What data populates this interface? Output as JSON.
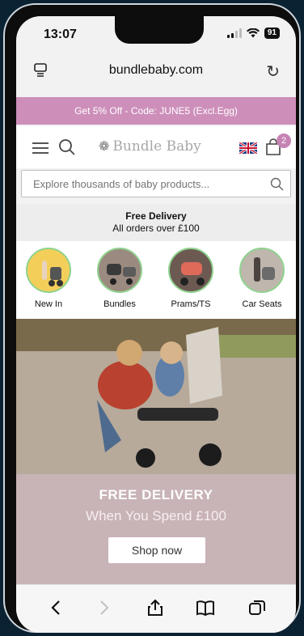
{
  "status": {
    "time": "13:07",
    "battery": "91"
  },
  "browser": {
    "url": "bundlebaby.com"
  },
  "promo": {
    "text": "Get 5% Off - Code: JUNE5 (Excl.Egg)"
  },
  "header": {
    "logo_text": "Bundle Baby",
    "cart_count": "2"
  },
  "search": {
    "placeholder": "Explore thousands of baby products..."
  },
  "delivery": {
    "title": "Free Delivery",
    "subtitle": "All orders over £100"
  },
  "categories": [
    {
      "label": "New In"
    },
    {
      "label": "Bundles"
    },
    {
      "label": "Prams/TS"
    },
    {
      "label": "Car Seats"
    }
  ],
  "hero": {
    "title": "FREE DELIVERY",
    "subtitle": "When You Spend £100",
    "button": "Shop now"
  },
  "colors": {
    "promo": "#cd8fba",
    "hero_bg": "#c8b3b7",
    "category_ring": "#8fd28f"
  },
  "icons": [
    "tabs-icon",
    "reload-icon",
    "menu-icon",
    "search-icon",
    "bundle-logo-icon",
    "uk-flag-icon",
    "cart-icon",
    "back-icon",
    "forward-icon",
    "share-icon",
    "bookmarks-icon",
    "tab-switcher-icon"
  ]
}
